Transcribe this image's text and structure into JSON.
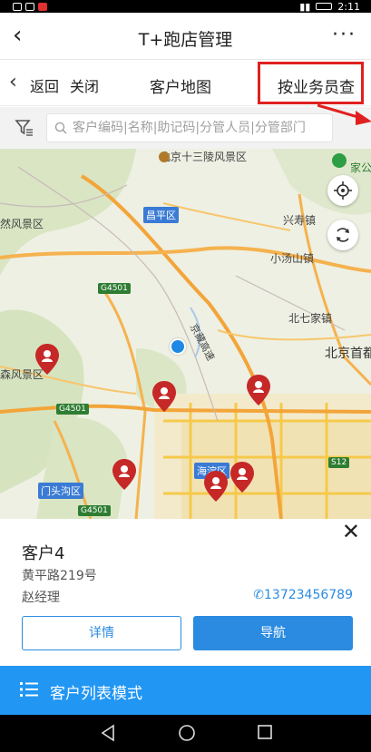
{
  "status_bar": {
    "time": "2:11"
  },
  "titlebar": {
    "back_glyph": "‹",
    "title": "T+跑店管理",
    "more_glyph": "···"
  },
  "navbar": {
    "back_label": "返回",
    "close_label": "关闭",
    "title": "客户地图",
    "by_salesperson_label": "按业务员查"
  },
  "search": {
    "placeholder": "客户编码|名称|助记码|分管人员|分管部门",
    "value": ""
  },
  "map": {
    "labels": [
      {
        "key": "ming_tombs",
        "text": "北京十三陵风景区"
      },
      {
        "key": "changping",
        "text": "昌平区"
      },
      {
        "key": "xingshou",
        "text": "兴寿镇"
      },
      {
        "key": "xiaotangshan",
        "text": "小汤山镇"
      },
      {
        "key": "beiqijia",
        "text": "北七家镇"
      },
      {
        "key": "capital_airport",
        "text": "北京首都"
      },
      {
        "key": "scenic_left",
        "text": "然风景区"
      },
      {
        "key": "scenic_left2",
        "text": "森风景区"
      },
      {
        "key": "mentougou",
        "text": "门头沟区"
      },
      {
        "key": "haidian",
        "text": "海淀区"
      },
      {
        "key": "expressway",
        "text": "京藏高速"
      },
      {
        "key": "home_park",
        "text": "家公"
      }
    ],
    "road_tags": [
      "G4501",
      "G4501",
      "G4501",
      "S12"
    ],
    "marker_icon": "map-pin-icon"
  },
  "customer_card": {
    "name": "客户4",
    "address": "黄平路219号",
    "contact": "赵经理",
    "phone": "13723456789",
    "detail_label": "详情",
    "navigate_label": "导航"
  },
  "list_mode": {
    "label": "客户列表模式"
  },
  "colors": {
    "accent": "#2196f3",
    "highlight_border": "#e02020",
    "pin": "#c62828"
  }
}
